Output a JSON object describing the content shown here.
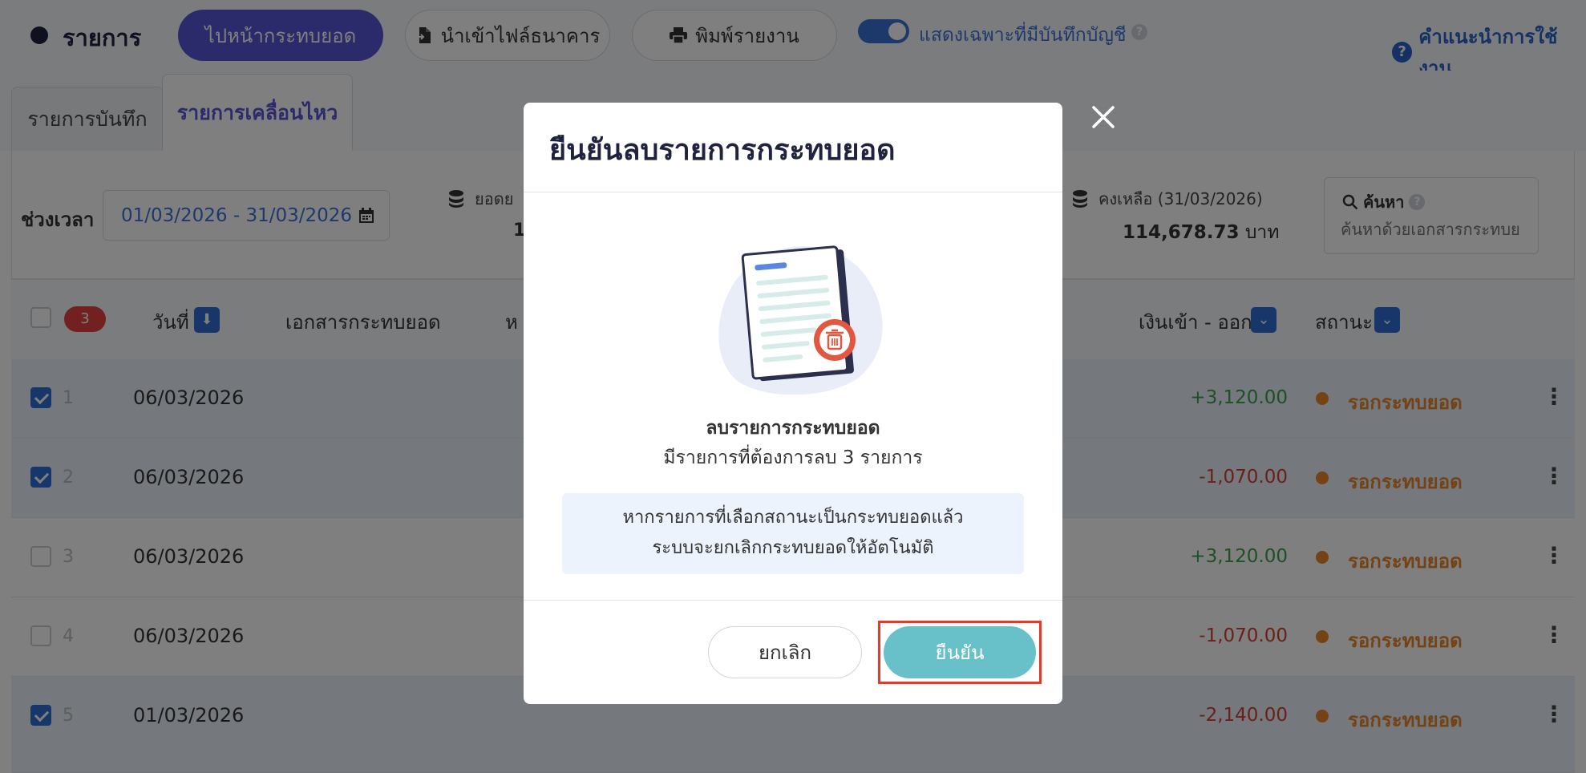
{
  "header": {
    "title": "รายการ",
    "btn_reconcile": "ไปหน้ากระทบยอด",
    "btn_import": "นำเข้าไฟล์ธนาคาร",
    "btn_print": "พิมพ์รายงาน",
    "toggle_label": "แสดงเฉพาะที่มีบันทึกบัญชี",
    "guide_label": "คำแนะนำการใช้งาน"
  },
  "tabs": [
    {
      "label": "รายการบันทึก",
      "active": false
    },
    {
      "label": "รายการเคลื่อนไหว",
      "active": true
    }
  ],
  "filter": {
    "period_label": "ช่วงเวลา",
    "date_range": "01/03/2026 - 31/03/2026",
    "opening_label": "ยอดย",
    "opening_value": "1",
    "closing_label": "คงเหลือ (31/03/2026)",
    "closing_amount": "114,678.73",
    "closing_unit": "บาท",
    "search_title": "ค้นหา",
    "search_placeholder": "ค้นหาด้วยเอกสารกระทบย"
  },
  "table": {
    "selected_count": "3",
    "headers": {
      "date": "วันที่",
      "doc": "เอกสารกระทบยอด",
      "note": "ห",
      "amount": "เงินเข้า - ออก",
      "status": "สถานะ"
    },
    "rows": [
      {
        "num": "1",
        "date": "06/03/2026",
        "amount": "+3,120.00",
        "status": "รอกระทบยอด",
        "checked": true
      },
      {
        "num": "2",
        "date": "06/03/2026",
        "amount": "-1,070.00",
        "status": "รอกระทบยอด",
        "checked": true
      },
      {
        "num": "3",
        "date": "06/03/2026",
        "amount": "+3,120.00",
        "status": "รอกระทบยอด",
        "checked": false
      },
      {
        "num": "4",
        "date": "06/03/2026",
        "amount": "-1,070.00",
        "status": "รอกระทบยอด",
        "checked": false
      },
      {
        "num": "5",
        "date": "01/03/2026",
        "amount": "-2,140.00",
        "status": "รอกระทบยอด",
        "checked": true
      }
    ]
  },
  "modal": {
    "title": "ยืนยันลบรายการกระทบยอด",
    "heading": "ลบรายการกระทบยอด",
    "sub": "มีรายการที่ต้องการลบ 3 รายการ",
    "info_line1": "หากรายการที่เลือกสถานะเป็นกระทบยอดแล้ว",
    "info_line2": "ระบบจะยกเลิกกระทบยอดให้อัตโนมัติ",
    "cancel": "ยกเลิก",
    "confirm": "ยืนยัน"
  },
  "colors": {
    "primary": "#5654d6",
    "link": "#3b73d9",
    "positive": "#3ca04a",
    "negative": "#d6402e",
    "pending": "#e8862a",
    "confirm": "#68c1c8",
    "highlight": "#e43a2a"
  },
  "icons": [
    "file-import-icon",
    "printer-icon",
    "help-icon",
    "calendar-icon",
    "coins-icon",
    "search-icon",
    "sort-down-icon",
    "chevron-down-icon",
    "kebab-icon",
    "close-icon",
    "trash-icon",
    "document-icon"
  ]
}
